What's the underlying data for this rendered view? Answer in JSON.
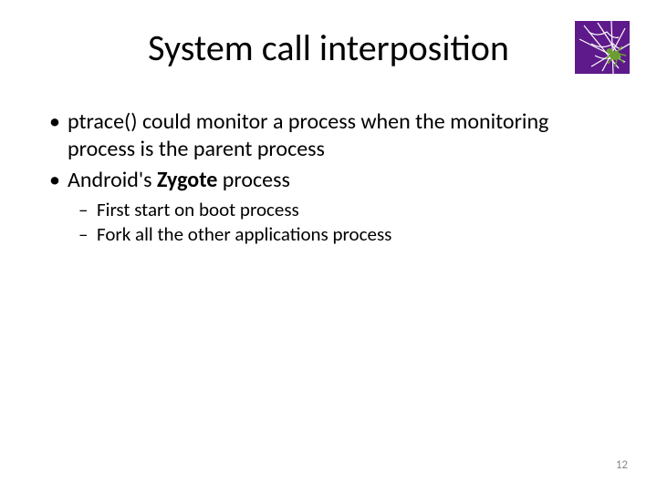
{
  "title": "System call interposition",
  "bullets": [
    {
      "level": 1,
      "text": "ptrace() could monitor a process when the monitoring process is the parent process"
    },
    {
      "level": 1,
      "prefix": "Android's ",
      "bold": "Zygote",
      "suffix": " process"
    },
    {
      "level": 2,
      "text": "First start on boot process"
    },
    {
      "level": 2,
      "text": "Fork all the other applications process"
    }
  ],
  "page_number": "12"
}
